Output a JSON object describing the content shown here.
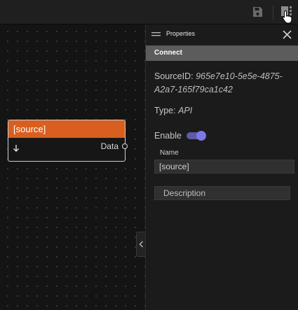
{
  "toolbar": {
    "save_icon": "save-icon",
    "panel_toggle_icon": "properties-panel-toggle-icon",
    "cursor_icon": "pointer-cursor-icon"
  },
  "canvas": {
    "node": {
      "title": "[source]",
      "input_icon": "arrow-down-icon",
      "output_port_label": "Data",
      "header_color": "#d85f1f"
    },
    "collapse_icon": "chevron-left-icon"
  },
  "properties_panel": {
    "title": "Properties",
    "menu_icon": "hamburger-icon",
    "close_icon": "close-icon",
    "section": "Connect",
    "source_id_label": "SourceID:",
    "source_id_value_line1": "965e7e10-5e5e-4875-",
    "source_id_value_line2": "A2a7-165f79ca1c42",
    "type_label": "Type:",
    "type_value": "API",
    "enable_label": "Enable",
    "enable_state": true,
    "toggle_color": "#7d78e8",
    "name_label": "Name",
    "name_value": "[source]",
    "description_placeholder": "Description"
  }
}
